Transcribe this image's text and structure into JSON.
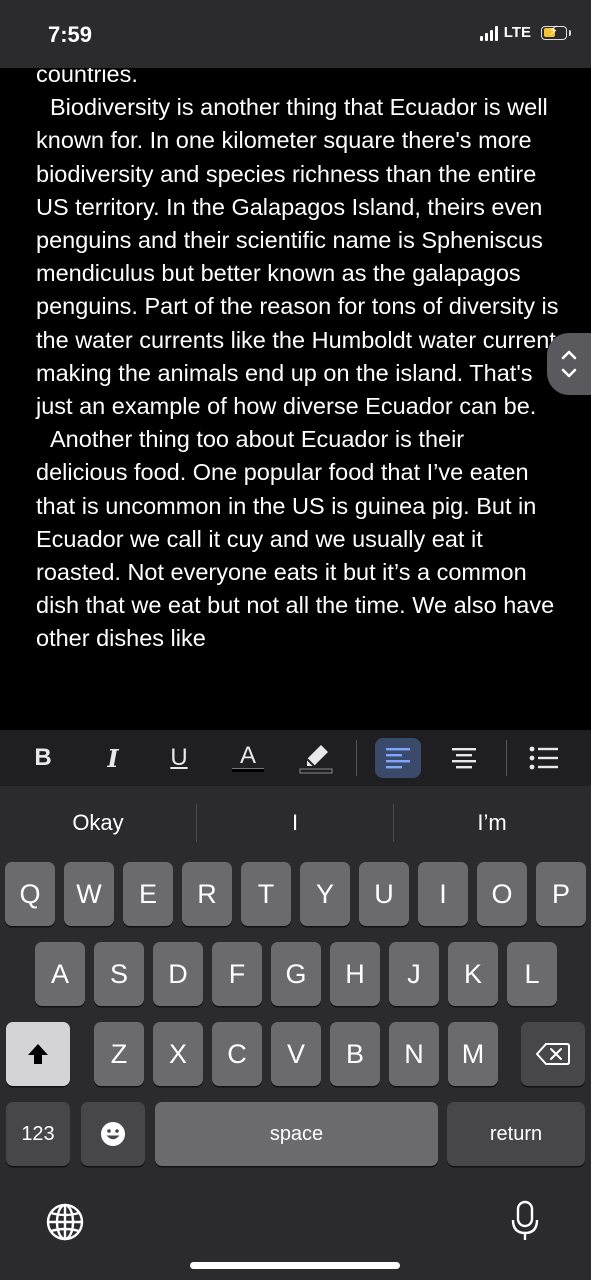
{
  "status": {
    "time": "7:59",
    "network": "LTE",
    "battery_level": 0.55,
    "battery_color": "#f4c430",
    "charging": true
  },
  "document": {
    "paragraphs": [
      "countries.",
      "Biodiversity is another thing that Ecuador is well known for. In one kilometer square there's more biodiversity and species richness than the entire US territory. In the Galapagos Island, theirs even penguins and their scientific name is Spheniscus mendiculus but better known as the galapagos penguins. Part of the reason for tons of diversity is the water currents like the Humboldt water current making the animals end up on the island. That's just an example of how diverse Ecuador can be.",
      "Another thing too about Ecuador is their delicious food. One popular food that I’ve eaten that is uncommon in the US is guinea pig. But in Ecuador we call it cuy and we usually eat it roasted. Not everyone eats it but it’s a common dish that we eat but not all the time. We also have other dishes like"
    ]
  },
  "format_toolbar": {
    "bold": "B",
    "italic": "I",
    "underline": "U",
    "text_color": "A",
    "active_align": "left",
    "active_color": "#3b4a6b",
    "icons": [
      "highlight-icon",
      "align-left-icon",
      "align-center-icon",
      "bulleted-list-icon"
    ]
  },
  "suggestions": [
    "Okay",
    "I",
    "I’m"
  ],
  "keyboard": {
    "row1": [
      "Q",
      "W",
      "E",
      "R",
      "T",
      "Y",
      "U",
      "I",
      "O",
      "P"
    ],
    "row2": [
      "A",
      "S",
      "D",
      "F",
      "G",
      "H",
      "J",
      "K",
      "L"
    ],
    "row3": [
      "Z",
      "X",
      "C",
      "V",
      "B",
      "N",
      "M"
    ],
    "numbers": "123",
    "space": "space",
    "return": "return",
    "icons": [
      "shift-icon",
      "backspace-icon",
      "emoji-icon",
      "globe-icon",
      "microphone-icon"
    ]
  }
}
